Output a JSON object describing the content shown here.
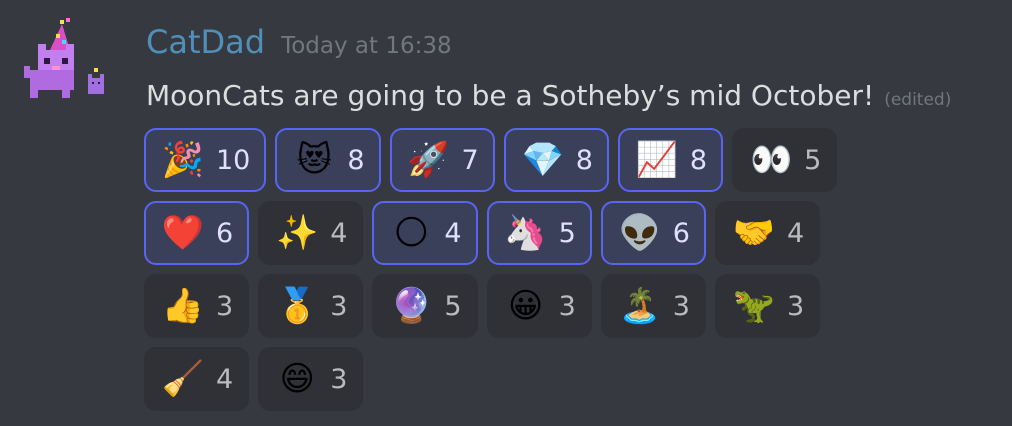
{
  "message": {
    "username": "CatDad",
    "timestamp": "Today at 16:38",
    "text": "MoonCats are going to be a Sotheby’s mid October!",
    "edited": "(edited)"
  },
  "colors": {
    "background": "#36393f",
    "username": "#508fb9",
    "reaction_selected_border": "#5865f2",
    "reaction_selected_bg": "#3b405a",
    "reaction_bg": "#2f3136"
  },
  "reactions": [
    [
      {
        "emoji": "🎉",
        "name": "party-popper",
        "count": "10",
        "me": true
      },
      {
        "emoji": "😻",
        "name": "heart-eyes-cat",
        "count": "8",
        "me": true
      },
      {
        "emoji": "🚀",
        "name": "rocket",
        "count": "7",
        "me": true
      },
      {
        "emoji": "💎",
        "name": "gem",
        "count": "8",
        "me": true
      },
      {
        "emoji": "📈",
        "name": "chart-increasing",
        "count": "8",
        "me": true
      },
      {
        "emoji": "👀",
        "name": "eyes",
        "count": "5",
        "me": false
      }
    ],
    [
      {
        "emoji": "❤️",
        "name": "red-heart",
        "count": "6",
        "me": true
      },
      {
        "emoji": "✨",
        "name": "sparkles",
        "count": "4",
        "me": false
      },
      {
        "emoji": "🌕",
        "name": "full-moon",
        "count": "4",
        "me": true
      },
      {
        "emoji": "🦄",
        "name": "unicorn",
        "count": "5",
        "me": true
      },
      {
        "emoji": "👽",
        "name": "alien",
        "count": "6",
        "me": true
      },
      {
        "emoji": "🤝",
        "name": "handshake",
        "count": "4",
        "me": false
      }
    ],
    [
      {
        "emoji": "👍",
        "name": "thumbs-up",
        "count": "3",
        "me": false
      },
      {
        "emoji": "🥇",
        "name": "gold-medal",
        "count": "3",
        "me": false
      },
      {
        "emoji": "🔮",
        "name": "crystal-ball",
        "count": "5",
        "me": false
      },
      {
        "emoji": "😀",
        "name": "grinning-face",
        "count": "3",
        "me": false
      },
      {
        "emoji": "🏝️",
        "name": "desert-island",
        "count": "3",
        "me": false
      },
      {
        "emoji": "🦖",
        "name": "t-rex",
        "count": "3",
        "me": false
      }
    ],
    [
      {
        "emoji": "🧹",
        "name": "broom",
        "count": "4",
        "me": false
      },
      {
        "emoji": "😄",
        "name": "smiling-face",
        "count": "3",
        "me": false
      }
    ]
  ]
}
